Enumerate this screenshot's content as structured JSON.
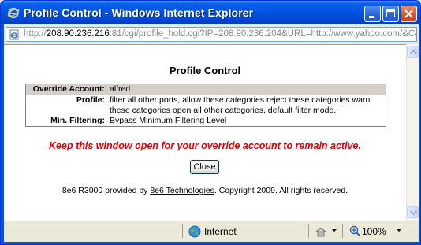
{
  "window": {
    "title": "Profile Control - Windows Internet Explorer"
  },
  "address": {
    "url_prefix": "http://",
    "url_host": "208.90.236.216",
    "url_rest": ":81/cgi/profile_hold.cgi?IP=208.90.236.204&URL=http://www.yahoo.com/&CA"
  },
  "page": {
    "title": "Profile Control",
    "rows": [
      {
        "label": "Override Account:",
        "value": "alfred"
      },
      {
        "label": "Profile:",
        "value": "filter all other ports, allow these categories reject these categories warn these categories open all other categories, default filter mode,"
      },
      {
        "label": "Min. Filtering:",
        "value": "Bypass Minimum Filtering Level"
      }
    ],
    "warning": "Keep this window open for your override account to remain active.",
    "close_label": "Close",
    "footer_pre": "8e6 R3000 provided by ",
    "footer_link": "8e6 Technologies",
    "footer_post": ". Copyright 2009. All rights reserved."
  },
  "status": {
    "zone": "Internet",
    "zoom": "100%"
  }
}
